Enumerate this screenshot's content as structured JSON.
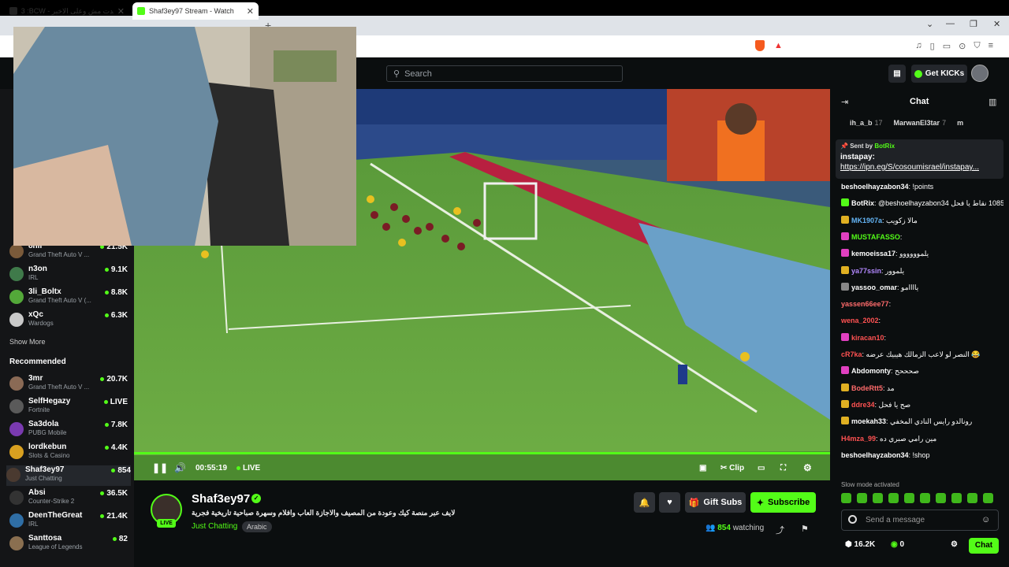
{
  "browser": {
    "tabs": [
      {
        "label": "3 :BCW - اتكلم قاعدت مش وعلى الاخير"
      },
      {
        "label": "Shaf3ey97 Stream - Watch Li..."
      }
    ],
    "new_tab": "+"
  },
  "header": {
    "search_placeholder": "Search",
    "get_kicks_label": "Get KICKs"
  },
  "sidebar": {
    "following_partial": [
      {
        "name": "8nil",
        "game": "Grand Theft Auto V ...",
        "viewers": "21.5K",
        "avatar_color": "#7a5a3a"
      },
      {
        "name": "n3on",
        "game": "IRL",
        "viewers": "9.1K",
        "avatar_color": "#3f7a4a"
      },
      {
        "name": "3li_Boltx",
        "game": "Grand Theft Auto V (...",
        "viewers": "8.8K",
        "avatar_color": "#53a839"
      },
      {
        "name": "xQc",
        "game": "Wardogs",
        "viewers": "6.3K",
        "avatar_color": "#c9c9c9"
      }
    ],
    "show_more": "Show More",
    "recommended_title": "Recommended",
    "recommended": [
      {
        "name": "3mr",
        "game": "Grand Theft Auto V ...",
        "viewers": "20.7K",
        "avatar_color": "#8a6a55"
      },
      {
        "name": "SelfHegazy",
        "game": "Fortnite",
        "viewers": "LIVE",
        "avatar_color": "#5a5a5a"
      },
      {
        "name": "Sa3dola",
        "game": "PUBG Mobile",
        "viewers": "7.8K",
        "avatar_color": "#7a3ab0"
      },
      {
        "name": "lordkebun",
        "game": "Slots & Casino",
        "viewers": "4.4K",
        "avatar_color": "#d8a020"
      },
      {
        "name": "Shaf3ey97",
        "game": "Just Chatting",
        "viewers": "854",
        "avatar_color": "#4a3a30"
      },
      {
        "name": "Absi",
        "game": "Counter-Strike 2",
        "viewers": "36.5K",
        "avatar_color": "#333"
      },
      {
        "name": "DeenTheGreat",
        "game": "IRL",
        "viewers": "21.4K",
        "avatar_color": "#2f6ea5"
      },
      {
        "name": "Santtosa",
        "game": "League of Legends",
        "viewers": "82",
        "avatar_color": "#8a6f50"
      }
    ]
  },
  "player": {
    "time": "00:55:19",
    "live_label": "LIVE",
    "clip_label": "Clip"
  },
  "channel": {
    "name": "Shaf3ey97",
    "live_badge": "LIVE",
    "title": "لايف عبر منصة كيك وعودة من المصيف والاجازة العاب وافلام وسهرة صباحية تاريخية فجرية",
    "category": "Just Chatting",
    "tag": "Arabic",
    "gift_subs": "Gift Subs",
    "subscribe": "Subscribe",
    "viewers": "854",
    "watching": "watching"
  },
  "chat": {
    "title": "Chat",
    "top_gifters": [
      {
        "name": "ih_a_b",
        "count": "17"
      },
      {
        "name": "MarwanEl3tar",
        "count": "7"
      },
      {
        "name": "m",
        "count": ""
      }
    ],
    "pinned": {
      "sent_by_label": "Sent by",
      "sender": "BotRix",
      "line1": "instapay:",
      "link": "https://ipn.eg/S/cosoumisrael/instapay..."
    },
    "messages": [
      {
        "user": "beshoelhayzabon34",
        "text": "!points",
        "color": "#ffffff",
        "badge": ""
      },
      {
        "user": "BotRix",
        "text": "@beshoelhayzabon34 جمعت 1085 نقاط يا فحل",
        "color": "#ffffff",
        "badge": "#53fc18"
      },
      {
        "user": "MK1907a",
        "text": "مالا زكويب",
        "color": "#64b5f6",
        "badge": "#e0b022"
      },
      {
        "user": "MUSTAFASSO",
        "text": "",
        "color": "#53fc18",
        "badge": "#e040c0"
      },
      {
        "user": "kemoeissa17",
        "text": "يلموووووو",
        "color": "#ffffff",
        "badge": "#e040c0"
      },
      {
        "user": "ya77ssin",
        "text": "يلموور",
        "color": "#b388ff",
        "badge": "#e0b022"
      },
      {
        "user": "yassoo_omar",
        "text": "ياااامو",
        "color": "#ffffff",
        "badge": "#888888"
      },
      {
        "user": "yassen66ee77",
        "text": "",
        "color": "#ff6b6b",
        "badge": ""
      },
      {
        "user": "wena_2002",
        "text": "",
        "color": "#ff5252",
        "badge": ""
      },
      {
        "user": "kiracan10",
        "text": "",
        "color": "#ff5252",
        "badge": "#e040c0"
      },
      {
        "user": "cR7ka",
        "text": "النصر لو لاعب الزمالك هيبيك عرضه 😂",
        "color": "#ff5252",
        "badge": ""
      },
      {
        "user": "Abdomonty",
        "text": "صحححح",
        "color": "#ffffff",
        "badge": "#e040c0"
      },
      {
        "user": "BodeRtt5",
        "text": "مد",
        "color": "#ff6b6b",
        "badge": "#e0b022"
      },
      {
        "user": "ddre34",
        "text": "صح يا فحل",
        "color": "#ff5252",
        "badge": "#e0b022"
      },
      {
        "user": "moekah33",
        "text": "رونالدو رايس النادي المخفي",
        "color": "#ffffff",
        "badge": "#e0b022"
      },
      {
        "user": "H4mza_99",
        "text": "مين رامي صبري ده",
        "color": "#ff5252",
        "badge": ""
      },
      {
        "user": "beshoelhayzabon34",
        "text": "!shop",
        "color": "#ffffff",
        "badge": ""
      }
    ],
    "slow_mode": "Slow mode activated",
    "send_placeholder": "Send a message",
    "points": "16.2K",
    "kicks": "0",
    "chat_button": "Chat"
  },
  "colors": {
    "accent": "#53fc18",
    "background": "#0b0e0f",
    "sidebar": "#141517"
  }
}
